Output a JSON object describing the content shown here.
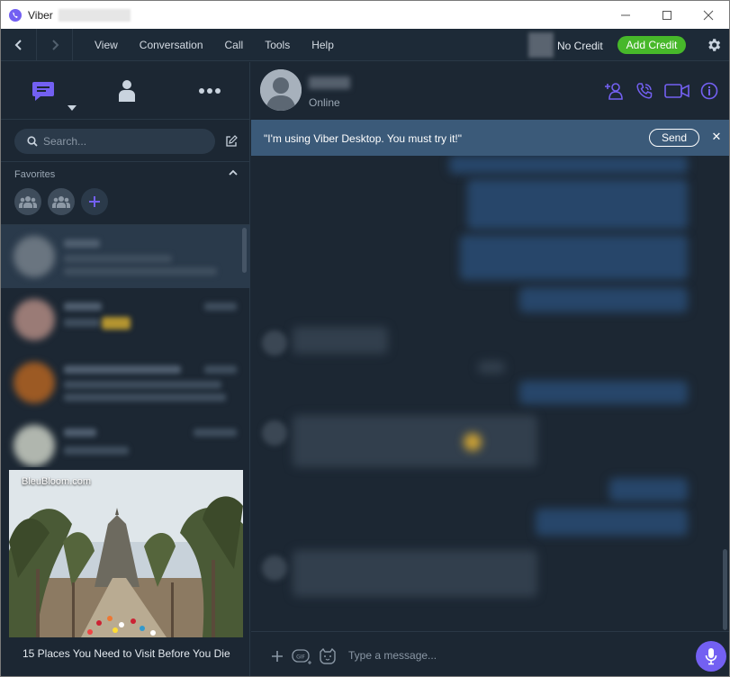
{
  "window": {
    "title": "Viber"
  },
  "menubar": {
    "items": [
      "View",
      "Conversation",
      "Call",
      "Tools",
      "Help"
    ],
    "credit_text": "No Credit",
    "add_credit_label": "Add Credit"
  },
  "sidebar": {
    "search_placeholder": "Search...",
    "favorites_label": "Favorites",
    "ad_source": "BleuBloom.com",
    "ad_caption": "15 Places You Need to Visit Before You Die"
  },
  "chat": {
    "status": "Online",
    "banner_text": "\"I'm using Viber Desktop. You must try it!\"",
    "banner_send_label": "Send",
    "composer_placeholder": "Type a message..."
  },
  "colors": {
    "accent": "#7360f2",
    "add_credit": "#47b82a",
    "banner": "#3b5a79",
    "background": "#1c2733"
  }
}
